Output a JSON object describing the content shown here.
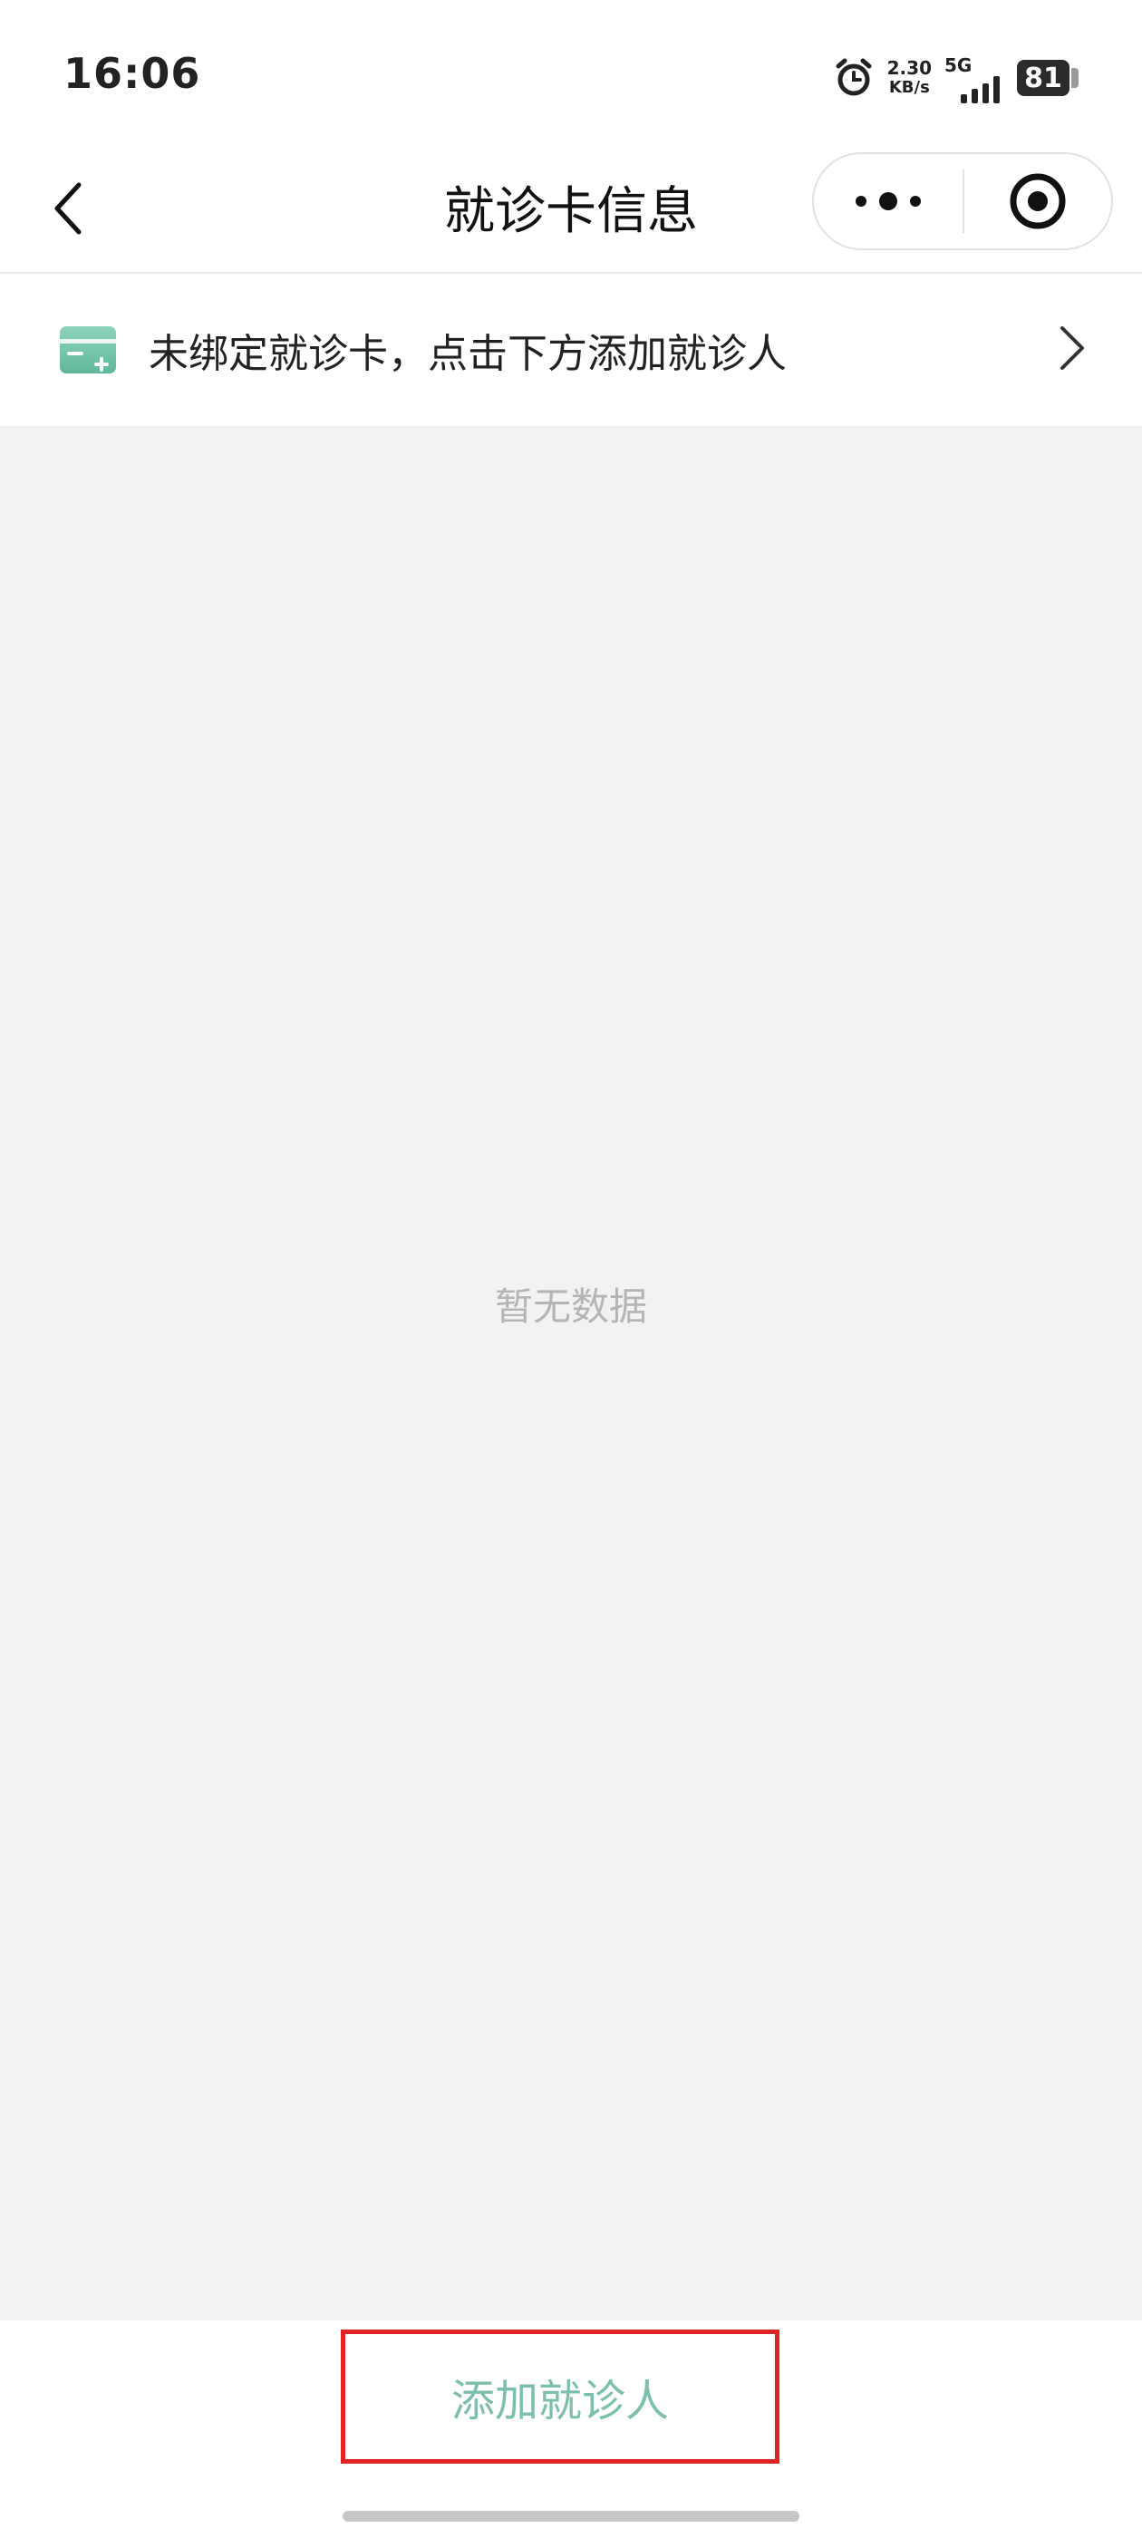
{
  "status_bar": {
    "time": "16:06",
    "net_speed_value": "2.30",
    "net_speed_unit": "KB/s",
    "network_type": "5G",
    "battery_level": "81",
    "icons": [
      "alarm-icon",
      "signal-icon",
      "battery-icon"
    ]
  },
  "nav": {
    "title": "就诊卡信息",
    "icons": [
      "back-arrow-icon",
      "more-dots-icon",
      "close-target-icon"
    ]
  },
  "notice": {
    "text": "未绑定就诊卡，点击下方添加就诊人",
    "icons": [
      "card-add-icon",
      "chevron-right-icon"
    ]
  },
  "content": {
    "empty_text": "暂无数据"
  },
  "bottom": {
    "add_button_label": "添加就诊人"
  },
  "colors": {
    "accent": "#7dbfae",
    "card_icon": "#6cc3a8",
    "highlight_border": "#e02424",
    "content_bg": "#f2f2f2",
    "empty_text": "#b5b5b5"
  }
}
